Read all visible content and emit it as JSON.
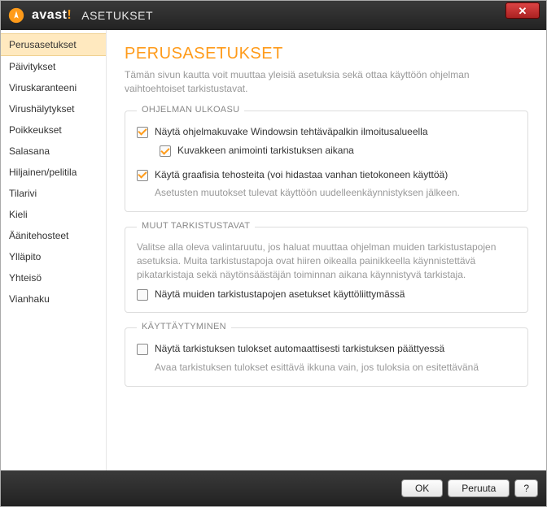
{
  "titlebar": {
    "brand": "avast",
    "bang": "!",
    "title": "ASETUKSET"
  },
  "sidebar": {
    "items": [
      {
        "label": "Perusasetukset",
        "active": true
      },
      {
        "label": "Päivitykset"
      },
      {
        "label": "Viruskaranteeni"
      },
      {
        "label": "Virushälytykset"
      },
      {
        "label": "Poikkeukset"
      },
      {
        "label": "Salasana"
      },
      {
        "label": "Hiljainen/pelitila"
      },
      {
        "label": "Tilarivi"
      },
      {
        "label": "Kieli"
      },
      {
        "label": "Äänitehosteet"
      },
      {
        "label": "Ylläpito"
      },
      {
        "label": "Yhteisö"
      },
      {
        "label": "Vianhaku"
      }
    ]
  },
  "main": {
    "heading": "PERUSASETUKSET",
    "subtitle": "Tämän sivun kautta voit muuttaa yleisiä asetuksia sekä ottaa käyttöön ohjelman vaihtoehtoiset tarkistustavat.",
    "group1": {
      "title": "OHJELMAN ULKOASU",
      "opt1": "Näytä ohjelmakuvake Windowsin tehtäväpalkin ilmoitusalueella",
      "opt1a": "Kuvakkeen animointi tarkistuksen aikana",
      "opt2": "Käytä graafisia tehosteita (voi hidastaa vanhan tietokoneen käyttöä)",
      "note": "Asetusten muutokset tulevat käyttöön uudelleenkäynnistyksen jälkeen."
    },
    "group2": {
      "title": "MUUT TARKISTUSTAVAT",
      "desc": "Valitse alla oleva valintaruutu, jos haluat muuttaa ohjelman muiden tarkistustapojen asetuksia. Muita tarkistustapoja ovat hiiren oikealla painikkeella käynnistettävä pikatarkistaja sekä näytönsäästäjän toiminnan aikana käynnistyvä tarkistaja.",
      "opt1": "Näytä muiden tarkistustapojen asetukset käyttöliittymässä"
    },
    "group3": {
      "title": "KÄYTTÄYTYMINEN",
      "opt1": "Näytä tarkistuksen tulokset automaattisesti tarkistuksen päättyessä",
      "note": "Avaa tarkistuksen tulokset esittävä ikkuna vain, jos tuloksia on esitettävänä"
    }
  },
  "footer": {
    "ok": "OK",
    "cancel": "Peruuta",
    "help": "?"
  }
}
